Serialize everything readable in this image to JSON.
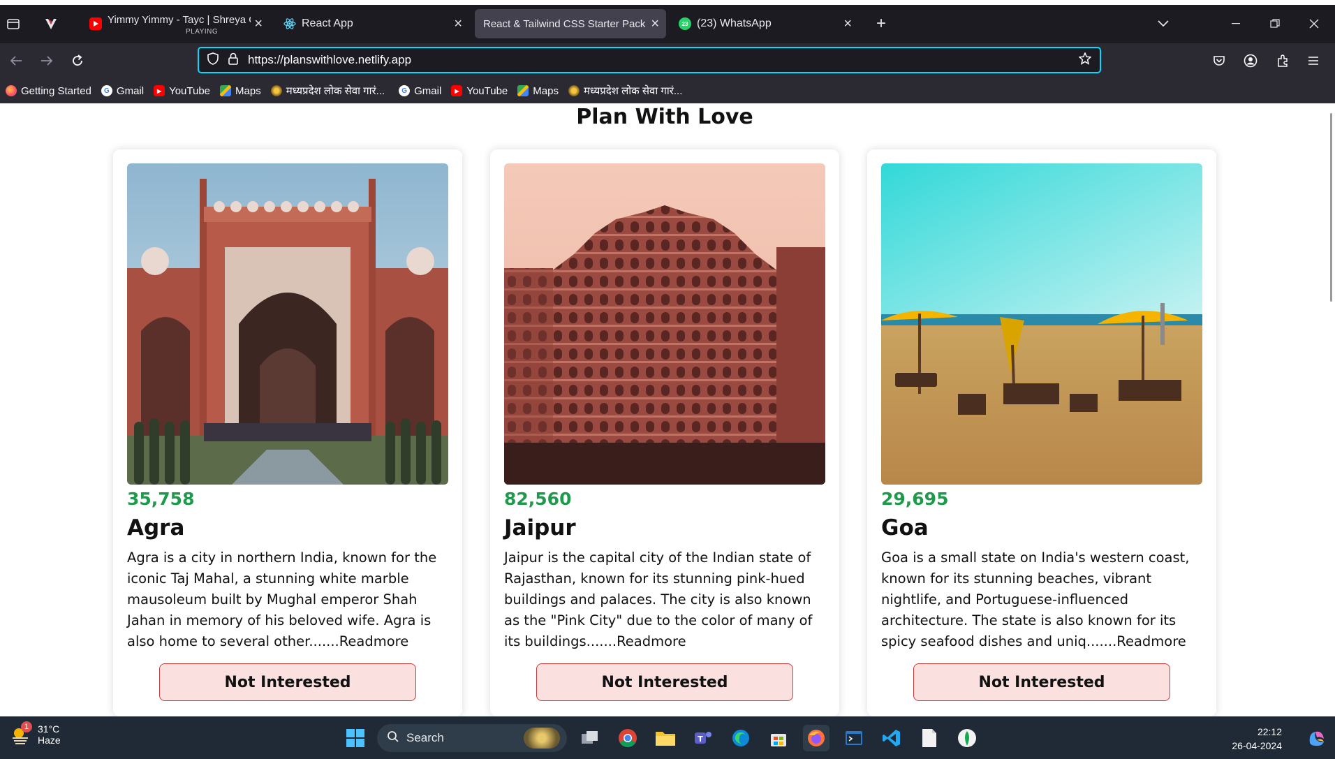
{
  "browser": {
    "tabs": [
      {
        "title": "Yimmy Yimmy - Tayc | Shreya G",
        "subtitle": "PLAYING",
        "active": false
      },
      {
        "title": "React App",
        "active": false
      },
      {
        "title": "React & Tailwind CSS Starter Pack",
        "active": true
      },
      {
        "title": "(23) WhatsApp",
        "active": false
      }
    ],
    "url": "https://planswithlove.netlify.app",
    "bookmarks": [
      {
        "label": "Getting Started",
        "icon": "firefox-icon"
      },
      {
        "label": "Gmail",
        "icon": "google-icon"
      },
      {
        "label": "YouTube",
        "icon": "youtube-icon"
      },
      {
        "label": "Maps",
        "icon": "maps-icon"
      },
      {
        "label": "मध्यप्रदेश लोक सेवा गारं...",
        "icon": "emblem-icon"
      },
      {
        "label": "Gmail",
        "icon": "google-icon"
      },
      {
        "label": "YouTube",
        "icon": "youtube-icon"
      },
      {
        "label": "Maps",
        "icon": "maps-icon"
      },
      {
        "label": "मध्यप्रदेश लोक सेवा गारं...",
        "icon": "emblem-icon"
      }
    ]
  },
  "page": {
    "title": "Plan With Love",
    "button_label": "Not Interested",
    "tours": [
      {
        "price": "35,758",
        "city": "Agra",
        "description": "Agra is a city in northern India, known for the iconic Taj Mahal, a stunning white marble mausoleum built by Mughal emperor Shah Jahan in memory of his beloved wife. Agra is also home to several other.......",
        "readmore": "Readmore"
      },
      {
        "price": "82,560",
        "city": "Jaipur",
        "description": "Jaipur is the capital city of the Indian state of Rajasthan, known for its stunning pink-hued buildings and palaces. The city is also known as the \"Pink City\" due to the color of many of its buildings.......",
        "readmore": "Readmore"
      },
      {
        "price": "29,695",
        "city": "Goa",
        "description": "Goa is a small state on India's western coast, known for its stunning beaches, vibrant nightlife, and Portuguese-influenced architecture. The state is also known for its spicy seafood dishes and uniq.......",
        "readmore": "Readmore"
      }
    ]
  },
  "taskbar": {
    "weather_temp": "31°C",
    "weather_cond": "Haze",
    "weather_badge": "1",
    "search_label": "Search",
    "time": "22:12",
    "date": "26-04-2024"
  }
}
